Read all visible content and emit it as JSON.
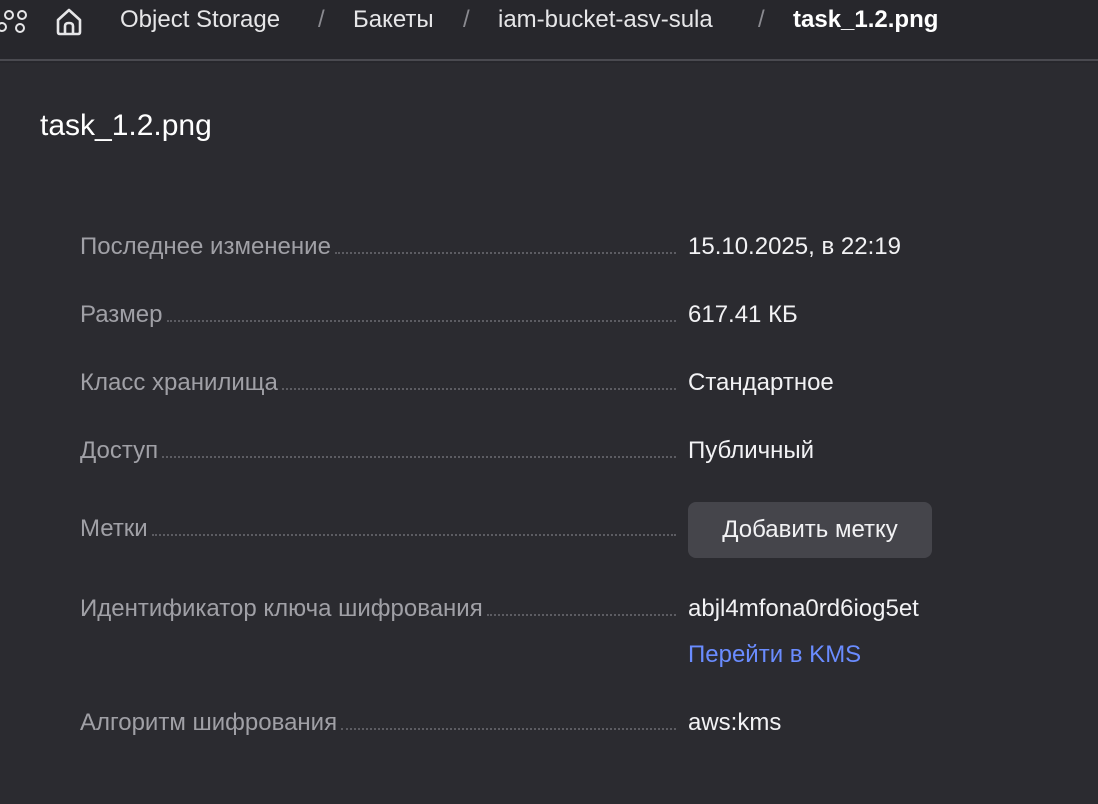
{
  "breadcrumb": {
    "items": [
      "Object Storage",
      "Бакеты",
      "iam-bucket-asv-sula"
    ],
    "current": "task_1.2.png",
    "separator": "/"
  },
  "page": {
    "title": "task_1.2.png"
  },
  "properties": {
    "last_modified": {
      "label": "Последнее изменение",
      "value": "15.10.2025, в 22:19"
    },
    "size": {
      "label": "Размер",
      "value": "617.41 КБ"
    },
    "storage_class": {
      "label": "Класс хранилища",
      "value": "Стандартное"
    },
    "access": {
      "label": "Доступ",
      "value": "Публичный"
    },
    "tags": {
      "label": "Метки",
      "button_label": "Добавить метку"
    },
    "encryption_key": {
      "label": "Идентификатор ключа шифрования",
      "value": "abjl4mfona0rd6iog5et",
      "link_label": "Перейти в KMS"
    },
    "encryption_algorithm": {
      "label": "Алгоритм шифрования",
      "value": "aws:kms"
    }
  },
  "colors": {
    "background": "#2b2b30",
    "header_background": "#27272c",
    "label": "#a0a0a6",
    "value": "#f2f2f4",
    "link": "#6a8cff",
    "button_background": "#45454b"
  },
  "icons": {
    "services": "nodes-icon",
    "home": "home-icon"
  }
}
